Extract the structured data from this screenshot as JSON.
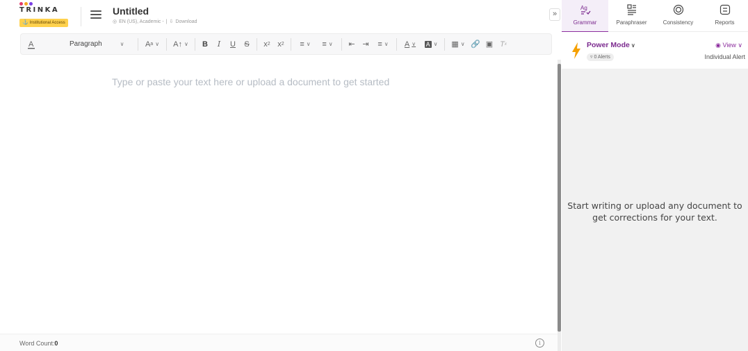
{
  "logo": {
    "text": "TRINKA",
    "dot_colors": [
      "#e23a6b",
      "#f5a623",
      "#7b3fe4"
    ]
  },
  "badge": {
    "label": "Institutional Access"
  },
  "document": {
    "title": "Untitled",
    "meta": "EN (US), Academic -",
    "download": "Download"
  },
  "toolbar": {
    "paragraph_label": "Paragraph"
  },
  "editor": {
    "placeholder": "Type or paste your text here or upload a document to get started"
  },
  "footer": {
    "word_count_label": "Word Count:",
    "word_count_value": "0"
  },
  "panel": {
    "tabs": [
      {
        "label": "Grammar",
        "icon": "grammar-icon",
        "active": true
      },
      {
        "label": "Paraphraser",
        "icon": "paraphraser-icon",
        "active": false
      },
      {
        "label": "Consistency",
        "icon": "consistency-icon",
        "active": false
      },
      {
        "label": "Reports",
        "icon": "reports-icon",
        "active": false
      }
    ],
    "mode": {
      "label": "Power Mode",
      "alerts": "0 Alerts"
    },
    "view": {
      "label": "View",
      "individual": "Individual Alert"
    },
    "empty_message": "Start writing or upload any document to get corrections for your text."
  },
  "colors": {
    "accent": "#8c2d9e",
    "badge": "#ffd14d",
    "bolt": "#f5a000"
  }
}
